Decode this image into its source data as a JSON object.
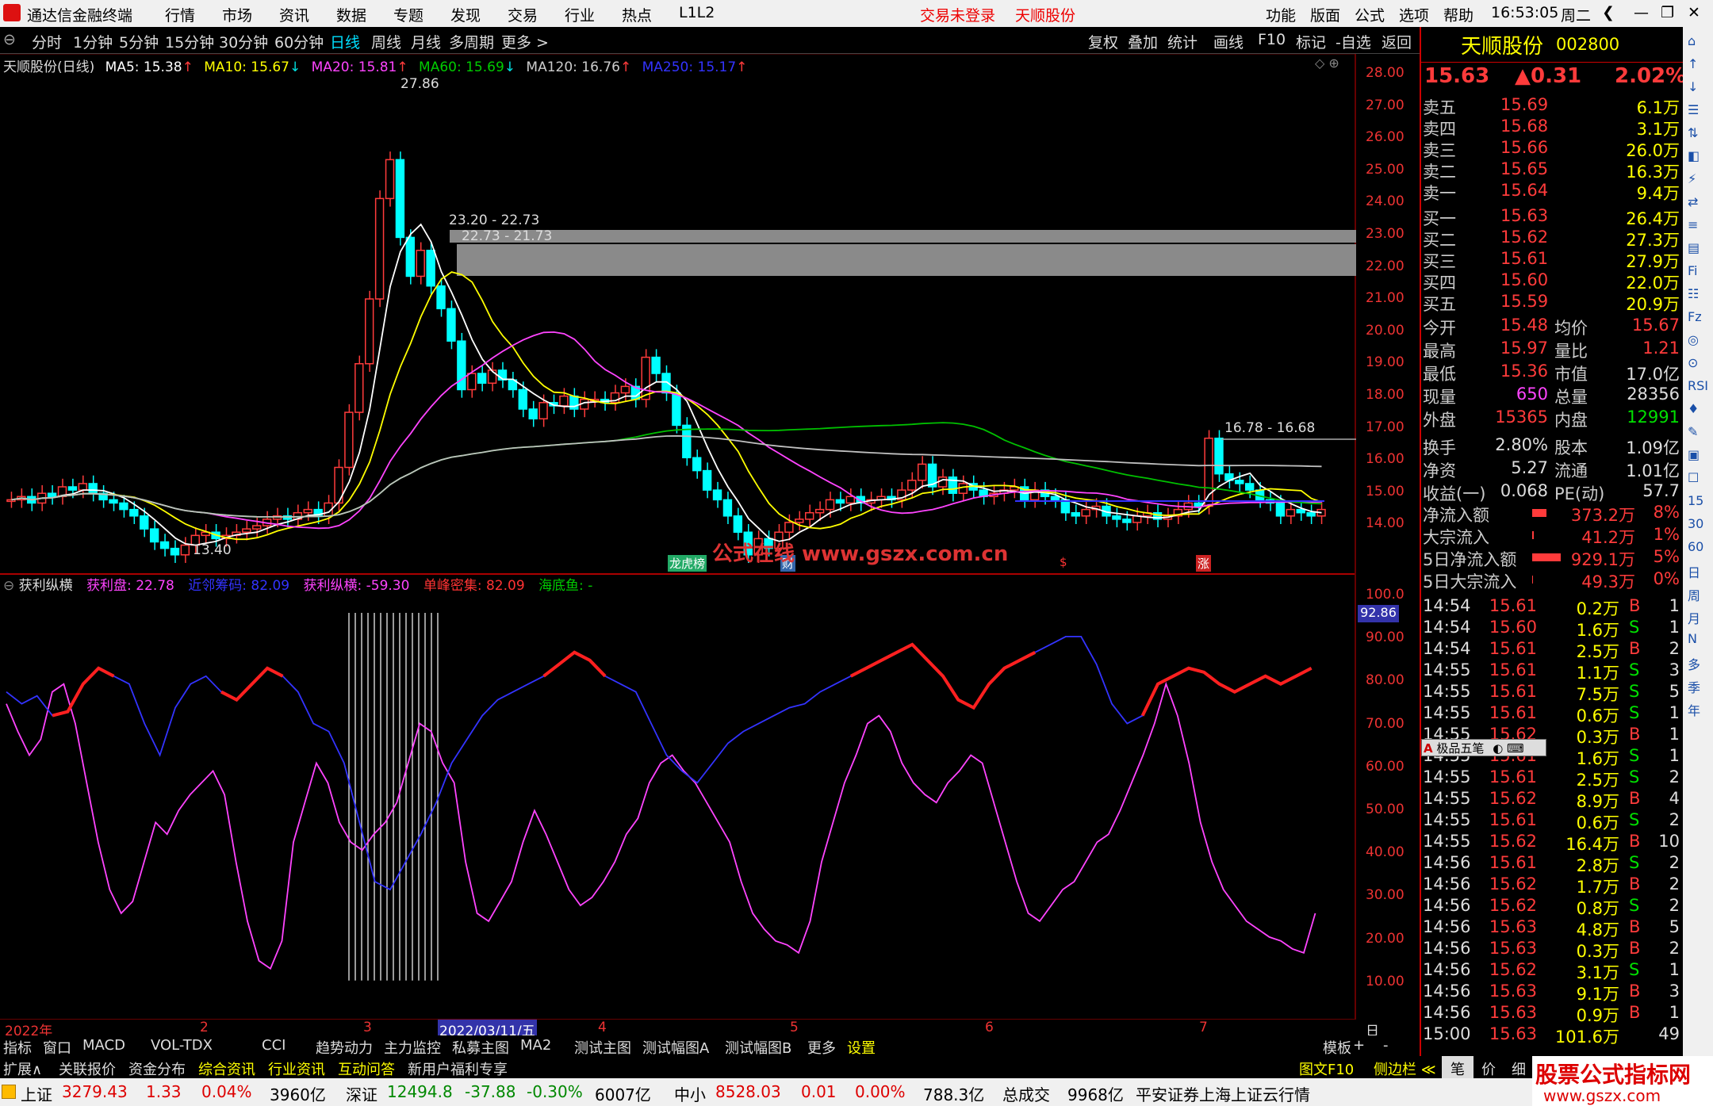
{
  "window": {
    "app_title": "通达信金融终端",
    "menu": [
      "行情",
      "市场",
      "资讯",
      "数据",
      "专题",
      "发现",
      "交易",
      "行业",
      "热点",
      "L1L2"
    ],
    "trade_status": "交易未登录",
    "stock_short": "天顺股份",
    "right_menu": [
      "功能",
      "版面",
      "公式",
      "选项",
      "帮助"
    ],
    "time": "16:53:05",
    "weekday": "周二"
  },
  "periods": [
    "分时",
    "1分钟",
    "5分钟",
    "15分钟",
    "30分钟",
    "60分钟",
    "日线",
    "周线",
    "月线",
    "多周期",
    "更多 >"
  ],
  "tools": [
    "复权",
    "叠加",
    "统计",
    "画线",
    "F10",
    "标记",
    "-自选",
    "返回"
  ],
  "main_legend": {
    "name": "天顺股份(日线)",
    "ma5": "MA5: 15.38",
    "ma10": "MA10: 15.67",
    "ma20": "MA20: 15.81",
    "ma60": "MA60: 15.69",
    "ma120": "MA120: 16.76",
    "ma250": "MA250: 15.17"
  },
  "main_annotations": {
    "high": "27.86",
    "low": "13.40",
    "range1": "23.20 - 22.73",
    "range2": "22.73 - 21.73",
    "range3": "16.78 - 16.68"
  },
  "markers": {
    "m1": "龙虎榜",
    "m2": "财",
    "m3": "$",
    "m4": "涨"
  },
  "watermark_chart": "公式在线  www.gszx.com.cn",
  "price_axis": [
    "28.00",
    "27.00",
    "26.00",
    "25.00",
    "24.00",
    "23.00",
    "22.00",
    "21.00",
    "20.00",
    "19.00",
    "18.00",
    "17.00",
    "16.00",
    "15.00",
    "14.00"
  ],
  "ind_legend": {
    "name": "获利纵横",
    "a": "获利盘: 22.78",
    "b": "近邻筹码: 82.09",
    "c": "获利纵横: -59.30",
    "d": "单峰密集: 82.09",
    "e": "海底鱼: -"
  },
  "ind_axis": [
    "100.0",
    "90.00",
    "80.00",
    "70.00",
    "60.00",
    "50.00",
    "40.00",
    "30.00",
    "20.00",
    "10.00"
  ],
  "ind_current": "92.86",
  "dates": [
    "2022年",
    "2",
    "3",
    "2022/03/11/五",
    "4",
    "5",
    "6",
    "7",
    "日线"
  ],
  "quote": {
    "name": "天顺股份",
    "code": "002800",
    "price": "15.63",
    "change": "▲0.31",
    "pct": "2.02%",
    "asks": [
      {
        "l": "卖五",
        "p": "15.69",
        "v": "6.1万"
      },
      {
        "l": "卖四",
        "p": "15.68",
        "v": "3.1万"
      },
      {
        "l": "卖三",
        "p": "15.66",
        "v": "26.0万"
      },
      {
        "l": "卖二",
        "p": "15.65",
        "v": "16.3万"
      },
      {
        "l": "卖一",
        "p": "15.64",
        "v": "9.4万"
      }
    ],
    "bids": [
      {
        "l": "买一",
        "p": "15.63",
        "v": "26.4万"
      },
      {
        "l": "买二",
        "p": "15.62",
        "v": "27.3万"
      },
      {
        "l": "买三",
        "p": "15.61",
        "v": "27.9万"
      },
      {
        "l": "买四",
        "p": "15.60",
        "v": "22.0万"
      },
      {
        "l": "买五",
        "p": "15.59",
        "v": "20.9万"
      }
    ],
    "stats": [
      [
        "今开",
        "15.48",
        "均价",
        "15.67"
      ],
      [
        "最高",
        "15.97",
        "量比",
        "1.21"
      ],
      [
        "最低",
        "15.36",
        "市值",
        "17.0亿"
      ],
      [
        "现量",
        "650",
        "总量",
        "28356"
      ],
      [
        "外盘",
        "15365",
        "内盘",
        "12991"
      ]
    ],
    "fund": [
      [
        "换手",
        "2.80%",
        "股本",
        "1.09亿"
      ],
      [
        "净资",
        "5.27",
        "流通",
        "1.01亿"
      ],
      [
        "收益(一)",
        "0.068",
        "PE(动)",
        "57.7"
      ]
    ],
    "flows": [
      [
        "净流入额",
        "373.2万",
        "8%"
      ],
      [
        "大宗流入",
        "41.2万",
        "1%"
      ],
      [
        "5日净流入额",
        "929.1万",
        "5%"
      ],
      [
        "5日大宗流入",
        "49.3万",
        "0%"
      ]
    ],
    "ticks": [
      [
        "14:54",
        "15.61",
        "0.2万",
        "B",
        "1"
      ],
      [
        "14:54",
        "15.60",
        "1.6万",
        "S",
        "1"
      ],
      [
        "14:54",
        "15.61",
        "2.5万",
        "B",
        "2"
      ],
      [
        "14:55",
        "15.61",
        "1.1万",
        "S",
        "3"
      ],
      [
        "14:55",
        "15.61",
        "7.5万",
        "S",
        "5"
      ],
      [
        "14:55",
        "15.61",
        "0.6万",
        "S",
        "1"
      ],
      [
        "14:55",
        "15.62",
        "0.3万",
        "B",
        "1"
      ],
      [
        "14:55",
        "15.61",
        "1.6万",
        "S",
        "1"
      ],
      [
        "14:55",
        "15.61",
        "2.5万",
        "S",
        "2"
      ],
      [
        "14:55",
        "15.62",
        "8.9万",
        "B",
        "4"
      ],
      [
        "14:55",
        "15.61",
        "0.6万",
        "S",
        "2"
      ],
      [
        "14:55",
        "15.62",
        "16.4万",
        "B",
        "10"
      ],
      [
        "14:56",
        "15.61",
        "2.8万",
        "S",
        "2"
      ],
      [
        "14:56",
        "15.62",
        "1.7万",
        "B",
        "2"
      ],
      [
        "14:56",
        "15.62",
        "0.8万",
        "S",
        "2"
      ],
      [
        "14:56",
        "15.63",
        "4.8万",
        "B",
        "5"
      ],
      [
        "14:56",
        "15.63",
        "0.3万",
        "B",
        "2"
      ],
      [
        "14:56",
        "15.62",
        "3.1万",
        "S",
        "1"
      ],
      [
        "14:56",
        "15.63",
        "9.1万",
        "B",
        "3"
      ],
      [
        "14:56",
        "15.63",
        "0.9万",
        "B",
        "1"
      ],
      [
        "15:00",
        "15.63",
        "101.6万",
        "",
        "49"
      ]
    ],
    "mini_popup": "极品五笔"
  },
  "bottom_tabs": [
    "指标",
    "窗口",
    "MACD",
    "VOL-TDX",
    "CCI",
    "趋势动力",
    "主力监控",
    "私募主图",
    "MA2",
    "测试主图",
    "测试幅图A",
    "测试幅图B",
    "更多",
    "设置",
    "模板",
    "+",
    "-"
  ],
  "status_row1": [
    "扩展∧",
    "关联报价",
    "资金分布",
    "综合资讯",
    "行业资讯",
    "互动问答",
    "新用户福利专享"
  ],
  "status_right1": [
    "图文F10",
    "侧边栏 ≪",
    "笔",
    "价",
    "细",
    "势"
  ],
  "index_bar": {
    "sh": "上证",
    "sh_v": "3279.43",
    "sh_c": "1.33",
    "sh_p": "0.04%",
    "sh_a": "3960亿",
    "sz": "深证",
    "sz_v": "12494.8",
    "sz_c": "-37.88",
    "sz_p": "-0.30%",
    "sz_a": "6007亿",
    "zx": "中小",
    "zx_v": "8528.03",
    "zx_c": "0.01",
    "zx_p": "0.00%",
    "zx_a": "788.3亿",
    "tot": "总成交",
    "tot_v": "9968亿",
    "broker": "平安证券上海上证云行情"
  },
  "site_logo": {
    "title": "股票公式指标网",
    "url": "www.gszx.com"
  },
  "side_icons": [
    "⌂",
    "↑",
    "↓",
    "☰",
    "⇅",
    "◧",
    "⚡",
    "⇄",
    "≡",
    "▤",
    "Fi",
    "☷",
    "Fz",
    "◎",
    "⊙",
    "RSI",
    "♦",
    "✎",
    "▣",
    "☐",
    "15",
    "30",
    "60",
    "日",
    "周",
    "月",
    "N",
    "多",
    "季",
    "年"
  ],
  "colors": {
    "up": "#ff3b3b",
    "down": "#00ffff",
    "ma5": "#ffffff",
    "ma10": "#ffff00",
    "ma20": "#ff44ff",
    "ma60": "#00c000",
    "ma120": "#c0c0c0",
    "ma250": "#3333ff"
  }
}
